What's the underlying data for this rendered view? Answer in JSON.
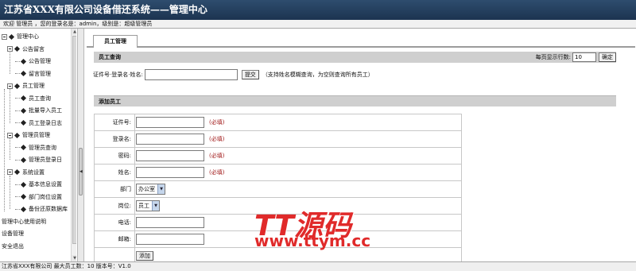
{
  "header": {
    "title": "江苏省XXX有限公司设备借还系统——管理中心"
  },
  "userbar": {
    "text": "欢迎 管理员 ，您的登录名是：admin，级别是：超级管理员"
  },
  "sidebar": {
    "items": [
      {
        "label": "管理中心",
        "level": 0,
        "type": "root"
      },
      {
        "label": "公告留言",
        "level": 1,
        "type": "folder"
      },
      {
        "label": "公告管理",
        "level": 2,
        "type": "leaf"
      },
      {
        "label": "留言管理",
        "level": 2,
        "type": "leaf"
      },
      {
        "label": "员工管理",
        "level": 1,
        "type": "folder"
      },
      {
        "label": "员工查询",
        "level": 2,
        "type": "leaf"
      },
      {
        "label": "批量导入员工",
        "level": 2,
        "type": "leaf"
      },
      {
        "label": "员工登录日志",
        "level": 2,
        "type": "leaf"
      },
      {
        "label": "管理员管理",
        "level": 1,
        "type": "folder"
      },
      {
        "label": "管理员查询",
        "level": 2,
        "type": "leaf"
      },
      {
        "label": "管理员登录日",
        "level": 2,
        "type": "leaf"
      },
      {
        "label": "系统设置",
        "level": 1,
        "type": "folder"
      },
      {
        "label": "基本信息设置",
        "level": 2,
        "type": "leaf"
      },
      {
        "label": "部门岗位设置",
        "level": 2,
        "type": "leaf"
      },
      {
        "label": "备份还原数据库",
        "level": 2,
        "type": "leaf"
      },
      {
        "label": "管理中心使用说明",
        "level": 0,
        "type": "link"
      },
      {
        "label": "设备管理",
        "level": 0,
        "type": "link"
      },
      {
        "label": "安全退出",
        "level": 0,
        "type": "link"
      }
    ]
  },
  "tab": {
    "label": "员工管理"
  },
  "query": {
    "section_title": "员工查询",
    "page_size_label": "每页显示行数:",
    "page_size_value": "10",
    "confirm_button": "确定",
    "search_label": "证件号·登录名·姓名:",
    "search_value": "",
    "submit_button": "提交",
    "hint": "（支持姓名模糊查询，为空则查询所有员工）"
  },
  "add": {
    "section_title": "添加员工",
    "required_text": "(必填)",
    "fields": {
      "id_label": "证件号:",
      "login_label": "登录名:",
      "password_label": "密码:",
      "name_label": "姓名:",
      "dept_label": "部门",
      "dept_value": "办公室",
      "post_label": "岗位:",
      "post_value": "员工",
      "phone_label": "电话:",
      "email_label": "邮箱:"
    },
    "add_button": "添加"
  },
  "statusbar": {
    "text": "江苏省XXX有限公司 最大员工数：10 版本号：V1.0"
  },
  "watermark": {
    "logo": "TT源码",
    "url": "www.ttym.cc"
  },
  "colors": {
    "header_bg": "#1c3450",
    "section_bg": "#cfcfcf",
    "required": "#a11a1a",
    "watermark": "#e02a2a"
  }
}
